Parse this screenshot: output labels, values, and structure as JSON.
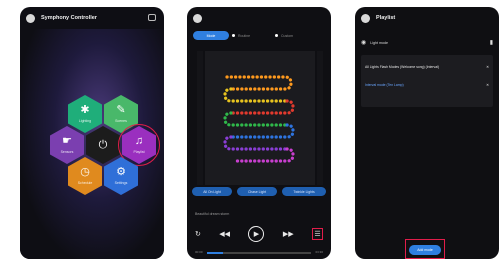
{
  "screen1": {
    "title": "Symphony Controller",
    "tiles": [
      {
        "label": "Lighting",
        "icon": "sparkle-icon"
      },
      {
        "label": "Scenes",
        "icon": "wand-icon"
      },
      {
        "label": "Sensors",
        "icon": "hand-icon"
      },
      {
        "label": "Power",
        "icon": "power-icon"
      },
      {
        "label": "Playlist",
        "icon": "music-icon"
      },
      {
        "label": "Schedule",
        "icon": "clock-icon"
      },
      {
        "label": "Settings",
        "icon": "gear-icon"
      }
    ],
    "colors": {
      "lighting": "#1fae7a",
      "scenes": "#49b86a",
      "sensors": "#7b3fb0",
      "power": "#1c1c1c",
      "playlist": "#9a2fbf",
      "schedule": "#e08a1e",
      "settings": "#2f6fd8",
      "highlight": "#e11d4a"
    }
  },
  "screen2": {
    "tabs": [
      "Mode",
      "Routine",
      "Custom"
    ],
    "buttons": [
      "All On Light",
      "Chase Light",
      "Twinkle Lights"
    ],
    "track_caption": "Beautiful dream storm",
    "time_start": "00:00",
    "time_end": "03:30",
    "progress": 0.15
  },
  "screen3": {
    "title": "Playlist",
    "list_label": "Light mode",
    "items": [
      {
        "name": "All Lights Flash Modes (Welcome song) (Interval)",
        "value": ""
      },
      {
        "name": "Interval mode (Ten Lamp)",
        "value": ""
      }
    ],
    "add_button": "Add mode"
  }
}
